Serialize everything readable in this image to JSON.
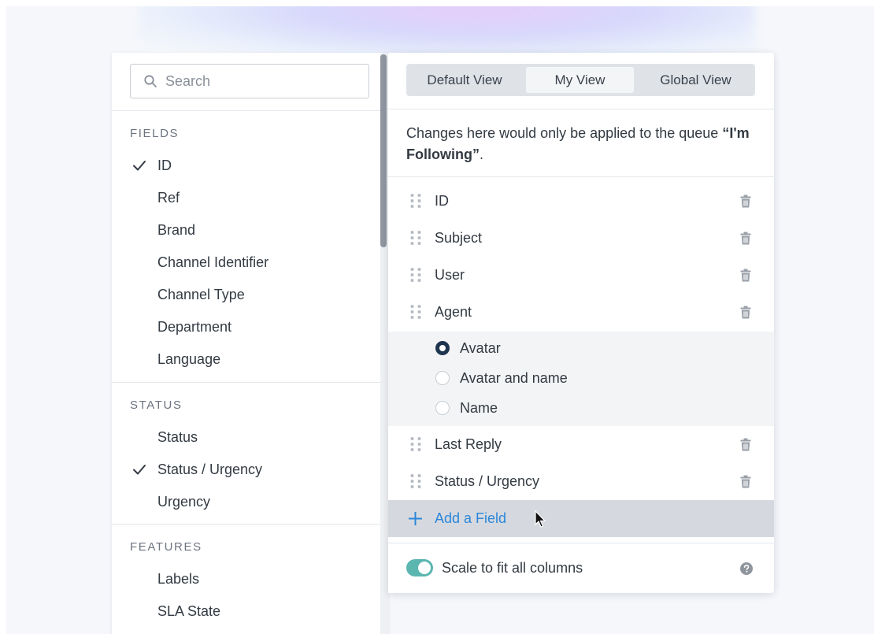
{
  "search": {
    "placeholder": "Search"
  },
  "fields_section": {
    "heading": "FIELDS",
    "items": [
      {
        "label": "ID",
        "checked": true
      },
      {
        "label": "Ref",
        "checked": false
      },
      {
        "label": "Brand",
        "checked": false
      },
      {
        "label": "Channel Identifier",
        "checked": false
      },
      {
        "label": "Channel Type",
        "checked": false
      },
      {
        "label": "Department",
        "checked": false
      },
      {
        "label": "Language",
        "checked": false
      }
    ]
  },
  "status_section": {
    "heading": "STATUS",
    "items": [
      {
        "label": "Status",
        "checked": false
      },
      {
        "label": "Status / Urgency",
        "checked": true
      },
      {
        "label": "Urgency",
        "checked": false
      }
    ]
  },
  "features_section": {
    "heading": "FEATURES",
    "items": [
      {
        "label": "Labels",
        "checked": false
      },
      {
        "label": "SLA State",
        "checked": false
      }
    ]
  },
  "view_tabs": [
    {
      "label": "Default View",
      "active": false
    },
    {
      "label": "My View",
      "active": true
    },
    {
      "label": "Global View",
      "active": false
    }
  ],
  "note": {
    "text_before": "Changes here would only be applied to the queue ",
    "queue_name": "“I'm Following”",
    "text_after": "."
  },
  "columns": [
    {
      "name": "ID"
    },
    {
      "name": "Subject"
    },
    {
      "name": "User"
    },
    {
      "name": "Agent"
    },
    {
      "name": "Last Reply"
    },
    {
      "name": "Status / Urgency"
    }
  ],
  "agent_display_options": [
    {
      "label": "Avatar",
      "selected": true
    },
    {
      "label": "Avatar and name",
      "selected": false
    },
    {
      "label": "Name",
      "selected": false
    }
  ],
  "add_field_label": "Add a Field",
  "scale_toggle": {
    "label": "Scale to fit all columns",
    "on": true
  },
  "colors": {
    "accent_blue": "#2d86d9",
    "toggle_teal": "#5bb6b0",
    "radio_dark": "#1e3550"
  },
  "icons": {
    "search": "search-icon",
    "check": "checkmark-icon",
    "drag": "drag-handle-icon",
    "delete": "trash-icon",
    "add": "plus-icon",
    "help": "help-icon"
  }
}
